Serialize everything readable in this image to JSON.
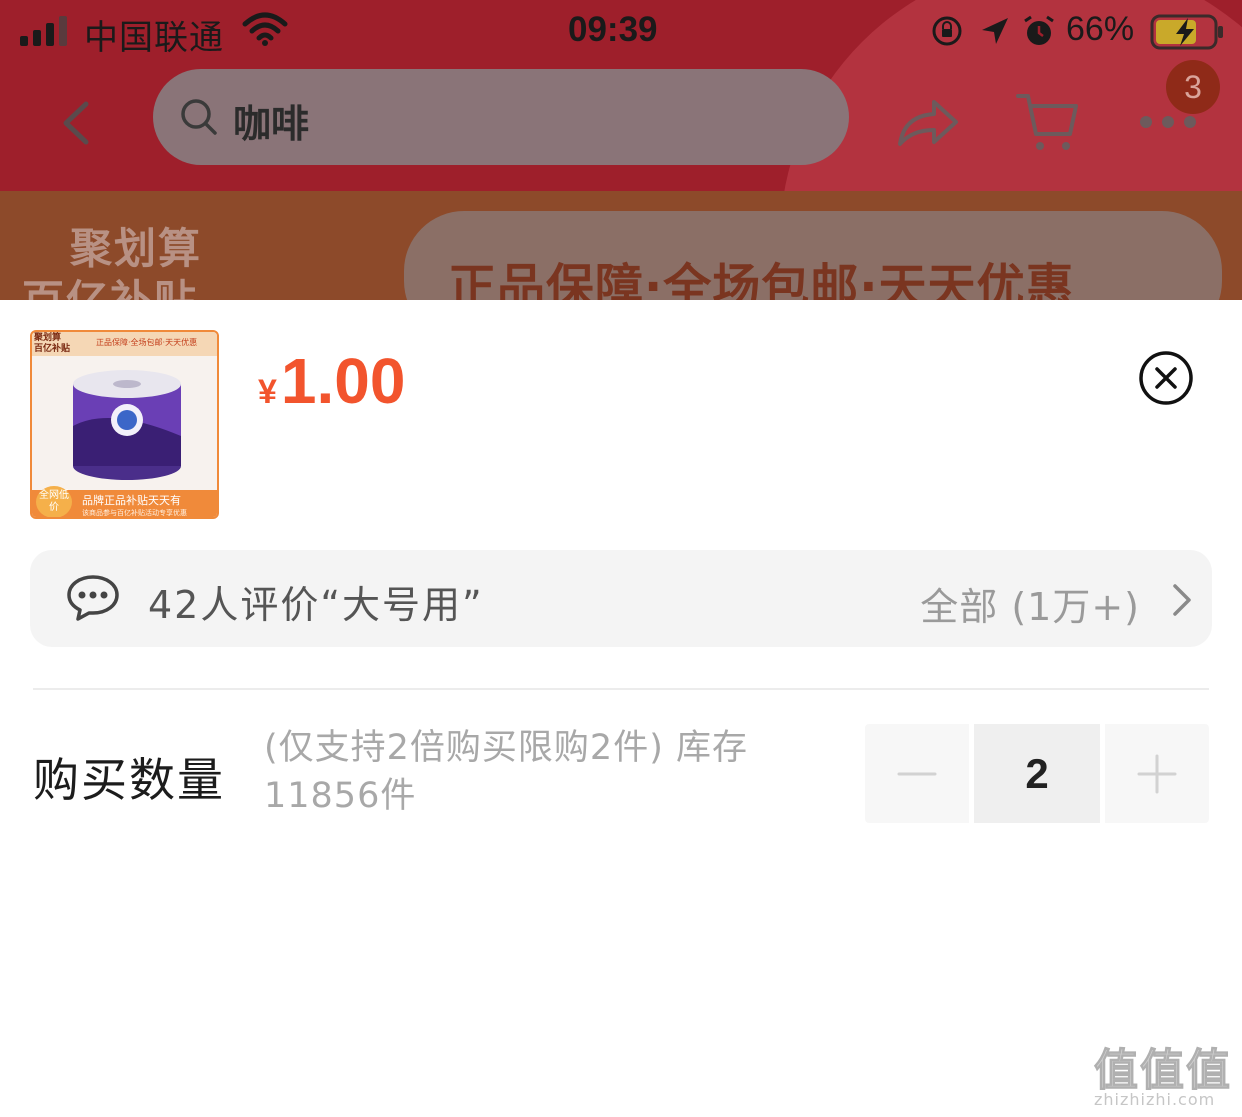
{
  "status_bar": {
    "carrier": "中国联通",
    "time": "09:39",
    "battery_percent": "66%"
  },
  "nav": {
    "search_text": "咖啡",
    "cart_badge": "3"
  },
  "promo": {
    "left_line1": "聚划算",
    "left_line2": "百亿补贴",
    "slogan": "正品保障·全场包邮·天天优惠"
  },
  "product": {
    "thumb": {
      "tag_brand": "聚划算\n百亿补贴",
      "tag_slogan": "正品保障·全场包邮·天天优惠",
      "low_price_badge": "全网低价",
      "bottom_text": "品牌正品补贴天天有",
      "bottom_sub": "该商品参与百亿补贴活动专享优惠"
    },
    "currency": "¥",
    "price": "1.00"
  },
  "review": {
    "summary": "42人评价“大号用”",
    "all_label": "全部 (1万+)"
  },
  "quantity": {
    "label": "购买数量",
    "note": "(仅支持2倍购买限购2件) 库存11856件",
    "value": "2"
  },
  "watermark": {
    "glyphs": "值值值",
    "url": "zhizhizhi.com"
  },
  "colors": {
    "price": "#f2542d",
    "app_header": "#9e1f2b",
    "review_bg": "#f4f4f4"
  },
  "icons": {
    "signal": "signal-icon",
    "wifi": "wifi-icon",
    "back": "chevron-left-icon",
    "search": "search-icon",
    "share": "share-icon",
    "cart": "cart-icon",
    "more": "more-icon",
    "close": "close-circle-icon",
    "comment": "comment-icon",
    "chevron": "chevron-right-icon",
    "minus": "minus-icon",
    "plus": "plus-icon"
  }
}
